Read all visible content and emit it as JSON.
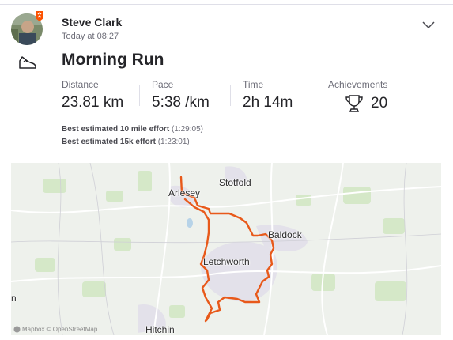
{
  "athlete": {
    "name": "Steve Clark",
    "timestamp": "Today at 08:27"
  },
  "activity": {
    "title": "Morning Run",
    "type_icon": "running-shoe-icon"
  },
  "stats": [
    {
      "label": "Distance",
      "value": "23.81 km"
    },
    {
      "label": "Pace",
      "value": "5:38 /km"
    },
    {
      "label": "Time",
      "value": "2h 14m"
    },
    {
      "label": "Achievements",
      "value": "20"
    }
  ],
  "efforts": [
    {
      "name": "Best estimated 10 mile effort",
      "value": "(1:29:05)"
    },
    {
      "name": "Best estimated 15k effort",
      "value": "(1:23:01)"
    }
  ],
  "map": {
    "towns": [
      "Stotfold",
      "Arlesey",
      "Baldock",
      "Letchworth",
      "Hitchin",
      "n"
    ],
    "attribution": "Mapbox © OpenStreetMap",
    "route_color": "#e8591a"
  },
  "colors": {
    "brand": "#fc5200",
    "text_primary": "#242428",
    "text_secondary": "#6d6d78"
  }
}
